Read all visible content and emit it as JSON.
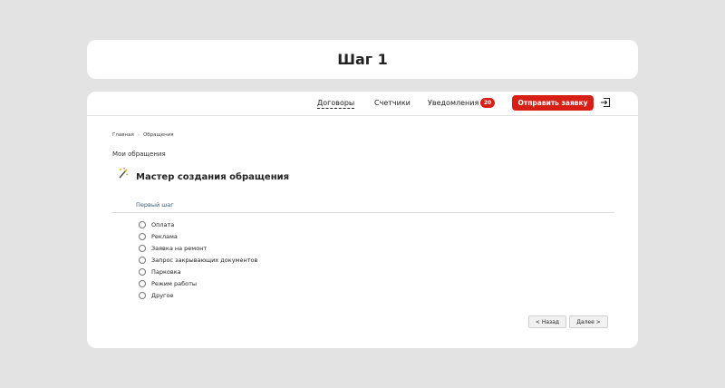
{
  "header_card": {
    "title": "Шаг 1"
  },
  "topbar": {
    "contracts": "Договоры",
    "counters": "Счетчики",
    "notifications": "Уведомления",
    "notifications_count": "20",
    "submit_button": "Отправить заявку"
  },
  "breadcrumb": {
    "home": "Главная",
    "separator": "›",
    "current": "Обращения"
  },
  "section_label": "Мои обращения",
  "wizard": {
    "title": "Мастер создания обращения",
    "step_label": "Первый шаг",
    "options": [
      "Оплата",
      "Реклама",
      "Заявка на ремонт",
      "Запрос закрывающих документов",
      "Парковка",
      "Режим работы",
      "Другое"
    ],
    "back_button": "< Назад",
    "next_button": "Далее >"
  },
  "colors": {
    "accent": "#d71f16",
    "background": "#e3e3e3"
  }
}
